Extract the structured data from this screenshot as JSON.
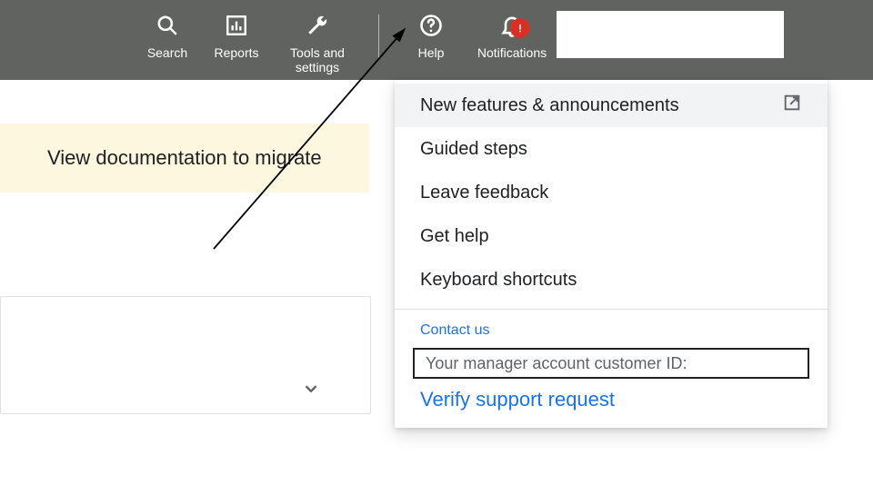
{
  "topbar": {
    "search_label": "Search",
    "reports_label": "Reports",
    "tools_label": "Tools and\nsettings",
    "help_label": "Help",
    "notifications_label": "Notifications",
    "notification_alert": "!"
  },
  "banner": {
    "text": "View documentation to migrate"
  },
  "help_menu": {
    "items": [
      "New features & announcements",
      "Guided steps",
      "Leave feedback",
      "Get help",
      "Keyboard shortcuts"
    ],
    "contact_header": "Contact us",
    "customer_id_label": "Your manager account customer ID:",
    "verify_link": "Verify support request"
  }
}
